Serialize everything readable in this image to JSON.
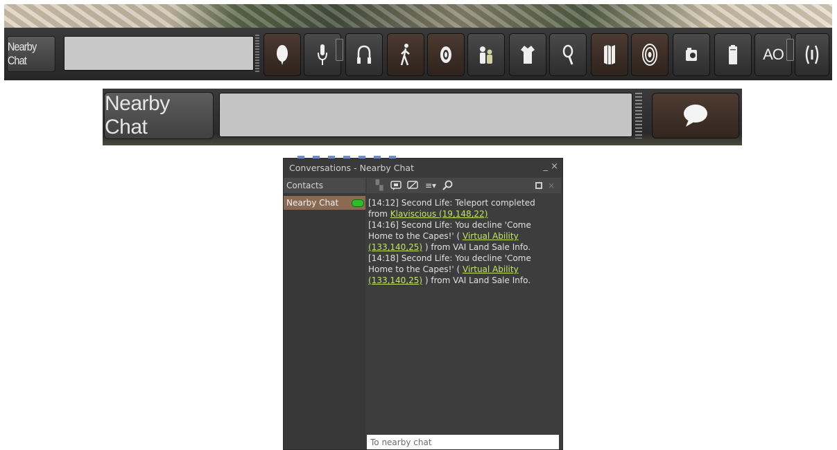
{
  "toolbar_strip": {
    "chat_label": "Nearby Chat",
    "chat_input_value": "",
    "buttons": [
      {
        "icon": "speak-bubble-icon",
        "glyph": "⬮"
      },
      {
        "icon": "microphone-icon",
        "glyph": "🎙"
      },
      {
        "icon": "headphones-icon",
        "glyph": "∩"
      },
      {
        "icon": "walk-icon",
        "glyph": "🚶"
      },
      {
        "icon": "camera-icon",
        "glyph": "◉"
      },
      {
        "icon": "people-icon",
        "glyph": "👥"
      },
      {
        "icon": "appearance-icon",
        "glyph": "👕"
      },
      {
        "icon": "search-icon",
        "glyph": "⚲"
      },
      {
        "icon": "map-icon",
        "glyph": "▥"
      },
      {
        "icon": "radar-icon",
        "glyph": "◎"
      },
      {
        "icon": "snapshot-icon",
        "glyph": "◘"
      },
      {
        "icon": "inventory-icon",
        "glyph": "▯"
      },
      {
        "icon": "ao-icon",
        "label": "AO"
      },
      {
        "icon": "gestures-icon",
        "glyph": "⦅⦆"
      }
    ]
  },
  "zoom_strip": {
    "chat_label": "Nearby Chat",
    "chat_input_value": ""
  },
  "window": {
    "title": "Conversations - Nearby Chat",
    "controls": "_ ×",
    "contacts_tab": "Contacts",
    "session_name": "Nearby Chat",
    "messages": [
      {
        "pre": "[14:12] Second Life: Teleport completed from ",
        "link": "Klaviscious (19,148,22)",
        "post": ""
      },
      {
        "pre": "[14:16] Second Life: You decline 'Come Home to the Capes!'  ( ",
        "link": "Virtual Ability (133,140,25)",
        "post": " ) from VAI Land Sale Info."
      },
      {
        "pre": "[14:18] Second Life: You decline 'Come Home to the Capes!'  ( ",
        "link": "Virtual Ability (133,140,25)",
        "post": " ) from VAI Land Sale Info."
      }
    ],
    "chat_placeholder": "To nearby chat"
  },
  "colors": {
    "link": "#c6e26a",
    "session_active": "#8a6a52",
    "voice_indicator": "#2bbf2b"
  }
}
